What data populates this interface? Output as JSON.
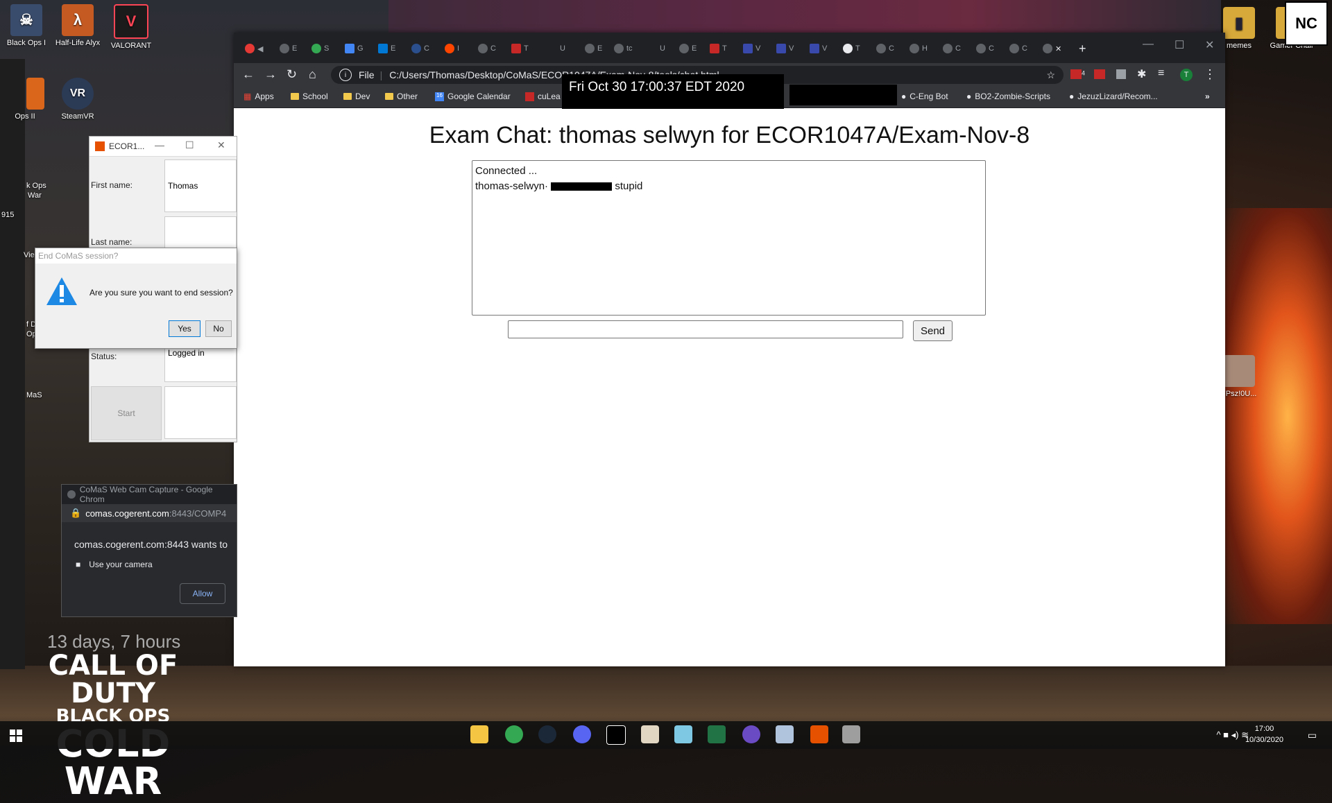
{
  "desktop": {
    "icons": [
      {
        "label": "Black Ops I"
      },
      {
        "label": "Half-Life Alyx"
      },
      {
        "label": "VALORANT"
      },
      {
        "label": "Ops II"
      },
      {
        "label": "SteamVR"
      },
      {
        "label": "memes"
      },
      {
        "label": "Gamer Chair"
      },
      {
        "label": "7Psz!0U..."
      }
    ],
    "strip_labels": [
      "k Ops",
      "War",
      "915",
      "Vie",
      "f D",
      "Op",
      "MaS"
    ],
    "countdown": "13 days, 7 hours",
    "game_logo": {
      "line1": "CALL OF DUTY",
      "line2": "BLACK OPS",
      "line3": "COLD WAR"
    },
    "qr_text": "NC"
  },
  "browser": {
    "tab_letters": [
      "E",
      "S",
      "G",
      "E",
      "C",
      "I",
      "C",
      "T",
      "U",
      "E",
      "tc",
      "U",
      "E",
      "T",
      "V",
      "V",
      "V",
      "T",
      "C",
      "H",
      "C",
      "C",
      "C"
    ],
    "url_scheme": "File",
    "url": "C:/Users/Thomas/Desktop/CoMaS/ECOR1047A/Exam-Nov-8/tools/chat.html",
    "bookmarks": [
      "Apps",
      "School",
      "Dev",
      "Other",
      "Google Calendar",
      "cuLea",
      "C-Eng Bot",
      "BO2-Zombie-Scripts",
      "JezuzLizard/Recom..."
    ],
    "overflow": "»",
    "avatar_letter": "T",
    "ext_badge": "4"
  },
  "overlay": {
    "datetime": "Fri Oct 30 17:00:37 EDT 2020"
  },
  "chat": {
    "title": "Exam Chat: thomas selwyn for ECOR1047A/Exam-Nov-8",
    "line1": "Connected ...",
    "line2_user": "thomas-selwyn·",
    "line2_msg": "stupid",
    "input_value": "",
    "send_label": "Send"
  },
  "ecor_window": {
    "title": "ECOR1...",
    "first_name_label": "First name:",
    "first_name_value": "Thomas",
    "last_name_label": "Last name:",
    "last_name_value": "",
    "status_label": "Status:",
    "status_value": "Logged in",
    "start_label": "Start"
  },
  "dialog": {
    "title": "End CoMaS session?",
    "message": "Are you sure you want to end session?",
    "yes": "Yes",
    "no": "No"
  },
  "camera_popup": {
    "title": "CoMaS Web Cam Capture - Google Chrom",
    "host": "comas.cogerent.com",
    "path": ":8443/COMP4",
    "message": "comas.cogerent.com:8443 wants to",
    "permission": "Use your camera",
    "allow": "Allow"
  },
  "taskbar": {
    "time": "17:00",
    "date": "10/30/2020"
  }
}
